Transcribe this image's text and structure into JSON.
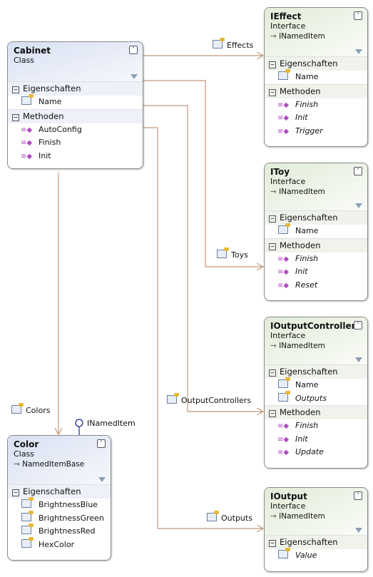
{
  "colors": {
    "connector": "#c4967a",
    "lollipop": "#1a2a90"
  },
  "classes": [
    {
      "id": "cabinet",
      "name": "Cabinet",
      "kind": "Class",
      "base": "",
      "style": "cls",
      "sections": [
        {
          "label": "Eigenschaften",
          "members": [
            {
              "name": "Name",
              "type": "property",
              "italic": false
            }
          ]
        },
        {
          "label": "Methoden",
          "members": [
            {
              "name": "AutoConfig",
              "type": "method",
              "italic": false
            },
            {
              "name": "Finish",
              "type": "method",
              "italic": false
            },
            {
              "name": "Init",
              "type": "method",
              "italic": false
            }
          ]
        }
      ]
    },
    {
      "id": "ieffect",
      "name": "IEffect",
      "kind": "Interface",
      "base": "INamedItem",
      "style": "ifc",
      "sections": [
        {
          "label": "Eigenschaften",
          "members": [
            {
              "name": "Name",
              "type": "property",
              "italic": false
            }
          ]
        },
        {
          "label": "Methoden",
          "members": [
            {
              "name": "Finish",
              "type": "method",
              "italic": true
            },
            {
              "name": "Init",
              "type": "method",
              "italic": true
            },
            {
              "name": "Trigger",
              "type": "method",
              "italic": true
            }
          ]
        }
      ]
    },
    {
      "id": "itoy",
      "name": "IToy",
      "kind": "Interface",
      "base": "INamedItem",
      "style": "ifc",
      "sections": [
        {
          "label": "Eigenschaften",
          "members": [
            {
              "name": "Name",
              "type": "property",
              "italic": false
            }
          ]
        },
        {
          "label": "Methoden",
          "members": [
            {
              "name": "Finish",
              "type": "method",
              "italic": true
            },
            {
              "name": "Init",
              "type": "method",
              "italic": true
            },
            {
              "name": "Reset",
              "type": "method",
              "italic": true
            }
          ]
        }
      ]
    },
    {
      "id": "ioutputcontroller",
      "name": "IOutputController",
      "kind": "Interface",
      "base": "INamedItem",
      "style": "ifc",
      "sections": [
        {
          "label": "Eigenschaften",
          "members": [
            {
              "name": "Name",
              "type": "property",
              "italic": false
            },
            {
              "name": "Outputs",
              "type": "property",
              "italic": true
            }
          ]
        },
        {
          "label": "Methoden",
          "members": [
            {
              "name": "Finish",
              "type": "method",
              "italic": true
            },
            {
              "name": "Init",
              "type": "method",
              "italic": true
            },
            {
              "name": "Update",
              "type": "method",
              "italic": true
            }
          ]
        }
      ]
    },
    {
      "id": "ioutput",
      "name": "IOutput",
      "kind": "Interface",
      "base": "INamedItem",
      "style": "ifc",
      "sections": [
        {
          "label": "Eigenschaften",
          "members": [
            {
              "name": "Value",
              "type": "property",
              "italic": true
            }
          ]
        }
      ]
    },
    {
      "id": "color",
      "name": "Color",
      "kind": "Class",
      "base": "NamedItemBase",
      "style": "cls",
      "sections": [
        {
          "label": "Eigenschaften",
          "members": [
            {
              "name": "BrightnessBlue",
              "type": "property",
              "italic": false
            },
            {
              "name": "BrightnessGreen",
              "type": "property",
              "italic": false
            },
            {
              "name": "BrightnessRed",
              "type": "property",
              "italic": false
            },
            {
              "name": "HexColor",
              "type": "property",
              "italic": false
            }
          ]
        }
      ]
    }
  ],
  "associations": [
    {
      "label": "Effects",
      "from": "Cabinet",
      "to": "IEffect"
    },
    {
      "label": "Toys",
      "from": "Cabinet",
      "to": "IToy"
    },
    {
      "label": "OutputControllers",
      "from": "Cabinet",
      "to": "IOutputController"
    },
    {
      "label": "Outputs",
      "from": "Cabinet",
      "to": "IOutput"
    },
    {
      "label": "Colors",
      "from": "Cabinet",
      "to": "Color"
    }
  ],
  "lollipop": {
    "label": "INamedItem",
    "on": "Color"
  }
}
